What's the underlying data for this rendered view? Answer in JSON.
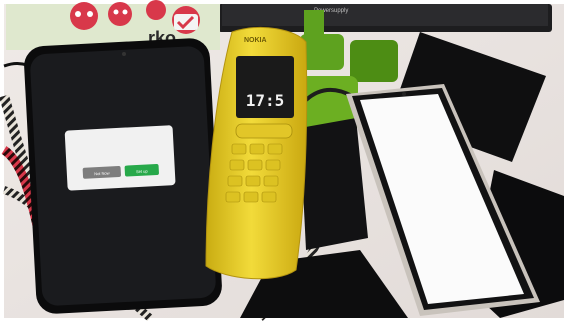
{
  "photo": {
    "monitor_label": "Powersupply",
    "sticker_text": "rko",
    "banana_phone": {
      "brand": "NOKIA",
      "clock": "17:5"
    },
    "dialog": {
      "left_button": "Not Now",
      "right_button": "Set up"
    },
    "colors": {
      "table": "#e9e3e0",
      "banana_yellow": "#e8cf2a",
      "dialog_green": "#27a94a",
      "sticker_red": "#d8384a",
      "sticker_green": "#5ea21f"
    }
  }
}
